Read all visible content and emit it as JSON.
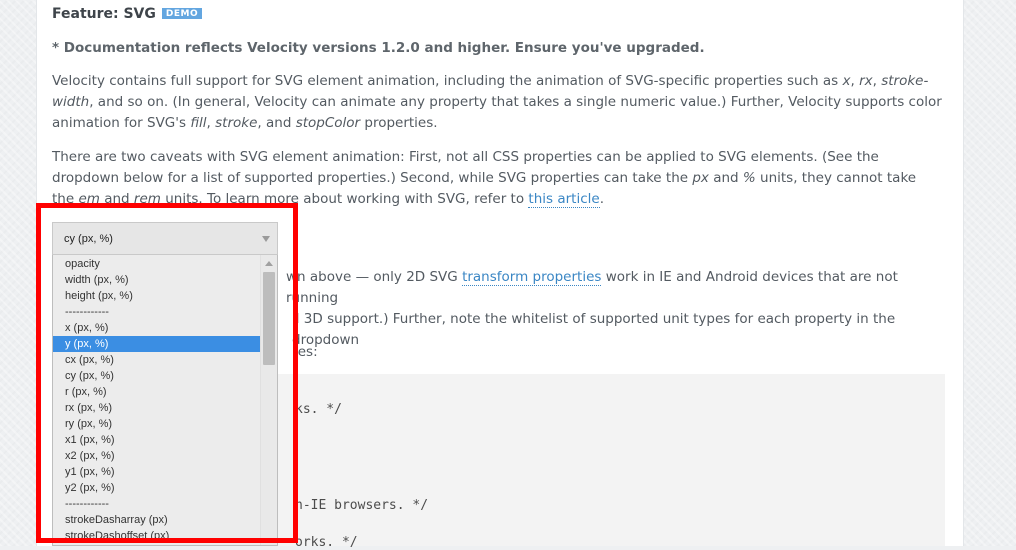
{
  "header": {
    "title": "Feature: SVG",
    "badge": "DEMO"
  },
  "note": "* Documentation reflects Velocity versions 1.2.0 and higher. Ensure you've upgraded.",
  "para1": {
    "t1": "Velocity contains full support for SVG element animation, including the animation of SVG-specific properties such as ",
    "x": "x",
    "t2": ", ",
    "rx": "rx",
    "t3": ", ",
    "stroke_width": "stroke-width",
    "t4": ", and so on. (In general, Velocity can animate any property that takes a single numeric value.) Further, Velocity supports color animation for SVG's ",
    "fill": "fill",
    "t5": ", ",
    "stroke": "stroke",
    "t6": ", and ",
    "stopColor": "stopColor",
    "t7": " properties."
  },
  "para2": {
    "t1": "There are two caveats with SVG element animation: First, not all CSS properties can be applied to SVG elements. (See the dropdown below for a list of supported properties.) Second, while SVG properties can take the ",
    "px": "px",
    "t2": " and ",
    "pct": "%",
    "t3": " units, they cannot take the ",
    "em": "em",
    "t4": " and ",
    "rem": "rem",
    "t5": " units. To learn more about working with SVG, refer to ",
    "link": "this article",
    "t6": "."
  },
  "para3": {
    "t1": "wn above — only 2D SVG ",
    "link": "transform properties",
    "t2": " work in IE and Android devices that are not running",
    "l2": "ll 3D support.) Further, note the whitelist of supported unit types for each property in the dropdown"
  },
  "para4": "ies:",
  "code_lines": [
    "ks. */",
    "n-IE browsers. */",
    "orks. */"
  ],
  "select": {
    "value": "cy (px, %)"
  },
  "dropdown": {
    "selected_index": 5,
    "options": [
      "opacity",
      "width (px, %)",
      "height (px, %)",
      "------------",
      "x (px, %)",
      "y (px, %)",
      "cx (px, %)",
      "cy (px, %)",
      "r (px, %)",
      "rx (px, %)",
      "ry (px, %)",
      "x1 (px, %)",
      "x2 (px, %)",
      "y1 (px, %)",
      "y2 (px, %)",
      "------------",
      "strokeDasharray (px)",
      "strokeDashoffset (px)"
    ]
  },
  "colors": {
    "link": "#3a86c4",
    "selected_option": "#3b8ee3",
    "highlight": "#ff0000",
    "badge": "#63a6e0"
  }
}
